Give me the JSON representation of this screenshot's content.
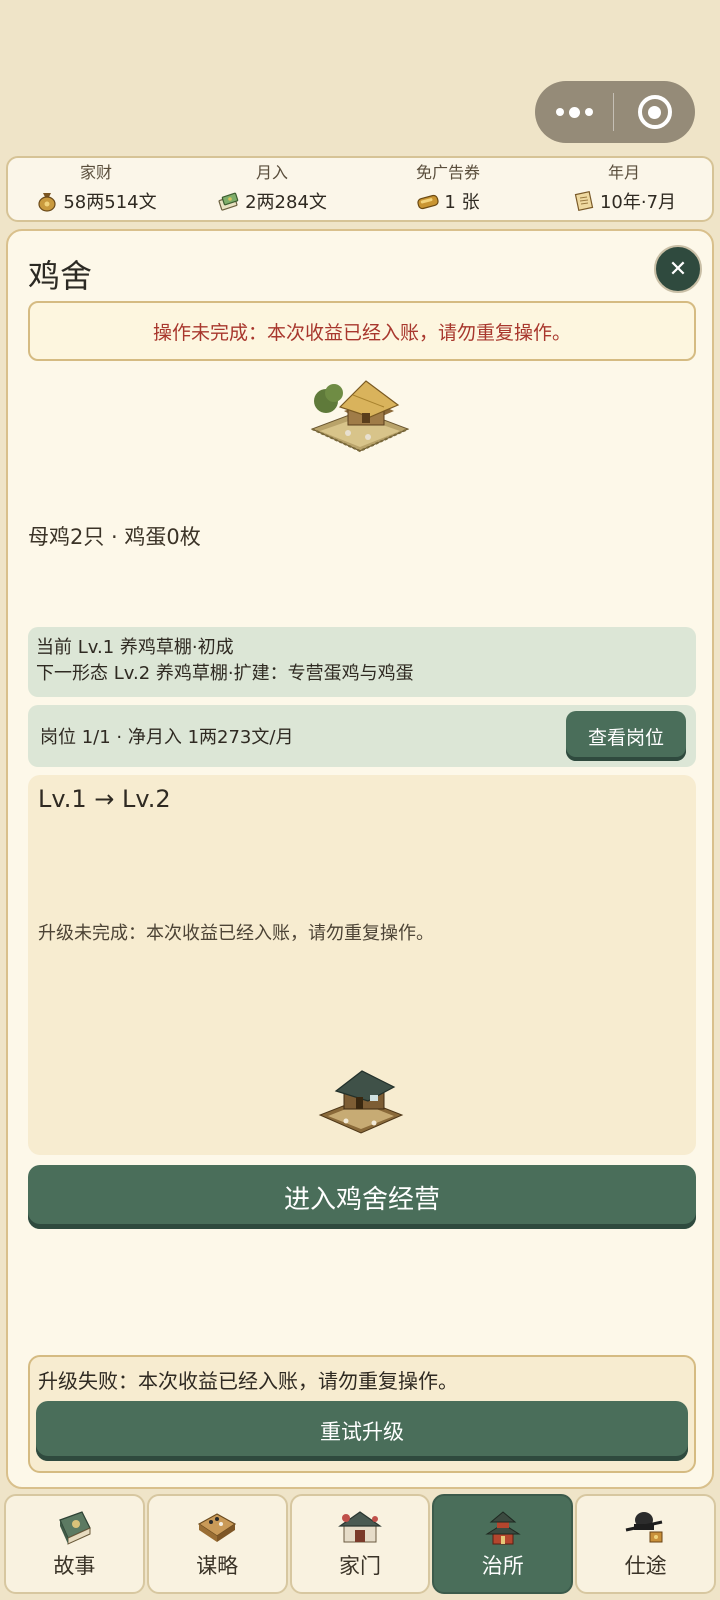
{
  "stats": [
    {
      "label": "家财",
      "value": "58两514文",
      "icon": "money-bag-icon"
    },
    {
      "label": "月入",
      "value": "2两284文",
      "icon": "banknote-icon"
    },
    {
      "label": "免广告券",
      "value": "1 张",
      "icon": "ticket-icon"
    },
    {
      "label": "年月",
      "value": "10年·7月",
      "icon": "scroll-icon"
    }
  ],
  "panel": {
    "title": "鸡舍",
    "close": "✕",
    "notice": "操作未完成：本次收益已经入账，请勿重复操作。",
    "counts": "母鸡2只 · 鸡蛋0枚",
    "form_current": "当前 Lv.1 养鸡草棚·初成",
    "form_next": "下一形态 Lv.2 养鸡草棚·扩建：专营蛋鸡与鸡蛋",
    "post_text": "岗位 1/1 · 净月入 1两273文/月",
    "view_post_label": "查看岗位",
    "upgrade_title": "Lv.1 → Lv.2",
    "upgrade_msg": "升级未完成：本次收益已经入账，请勿重复操作。",
    "enter_label": "进入鸡舍经营",
    "fail_msg": "升级失败：本次收益已经入账，请勿重复操作。",
    "retry_label": "重试升级"
  },
  "nav": [
    {
      "label": "故事",
      "icon": "book-icon",
      "active": false
    },
    {
      "label": "谋略",
      "icon": "strategy-board-icon",
      "active": false
    },
    {
      "label": "家门",
      "icon": "house-gate-icon",
      "active": false
    },
    {
      "label": "治所",
      "icon": "pavilion-icon",
      "active": true
    },
    {
      "label": "仕途",
      "icon": "official-hat-icon",
      "active": false
    }
  ]
}
